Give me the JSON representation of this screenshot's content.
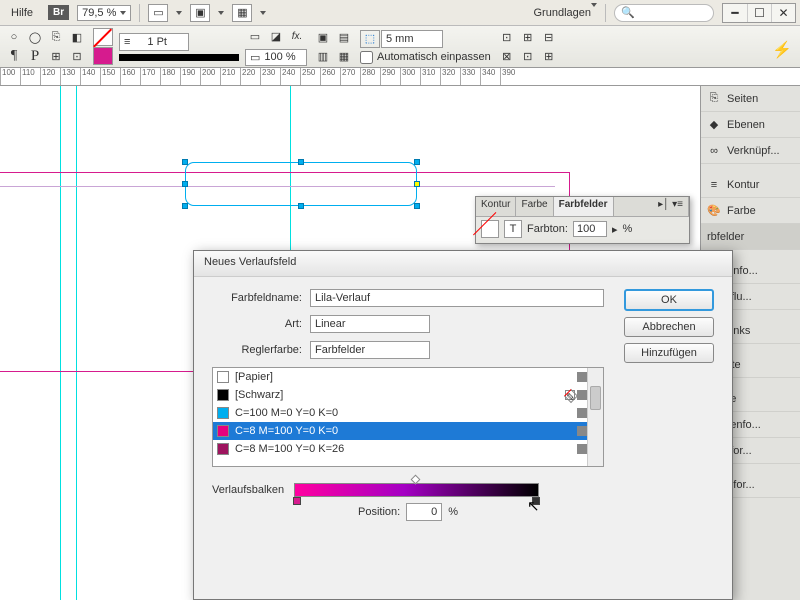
{
  "topbar": {
    "hilfe": "Hilfe",
    "br": "Br",
    "zoom": "79,5 %",
    "workspace": "Grundlagen"
  },
  "toolbar": {
    "stroke_wt": "1 Pt",
    "opacity": "100 %",
    "gap": "5 mm",
    "autofit": "Automatisch einpassen"
  },
  "ruler": [
    "100",
    "110",
    "120",
    "130",
    "140",
    "150",
    "160",
    "170",
    "180",
    "190",
    "200",
    "210",
    "220",
    "230",
    "240",
    "250",
    "260",
    "270",
    "280",
    "290",
    "300",
    "310",
    "320",
    "330",
    "340",
    "390"
  ],
  "rpanel": {
    "seiten": "Seiten",
    "ebenen": "Ebenen",
    "verkn": "Verknüpf...",
    "kontur": "Kontur",
    "farbe": "Farbe",
    "farbfelder": "rbfelder",
    "eichen": "eichenfo...",
    "extumfl": "xtumflu...",
    "yperlinks": "yperlinks",
    "ttribute": "ttribute",
    "abelle": "abelle",
    "abellenfo": "abellenfo...",
    "ellenfor": "ellenfor...",
    "bsatzfor": "bsatzfor..."
  },
  "farbpanel": {
    "t_kontur": "Kontur",
    "t_farbe": "Farbe",
    "t_farbfelder": "Farbfelder",
    "farbton_lbl": "Farbton:",
    "farbton_val": "100",
    "ohne": "[Ohn"
  },
  "dialog": {
    "title": "Neues Verlaufsfeld",
    "name_lbl": "Farbfeldname:",
    "name_val": "Lila-Verlauf",
    "art_lbl": "Art:",
    "art_val": "Linear",
    "regler_lbl": "Reglerfarbe:",
    "regler_val": "Farbfelder",
    "swatches": [
      {
        "name": "[Papier]",
        "color": "#ffffff"
      },
      {
        "name": "[Schwarz]",
        "color": "#000000",
        "noedit": true
      },
      {
        "name": "C=100 M=0 Y=0 K=0",
        "color": "#00aeef"
      },
      {
        "name": "C=8 M=100 Y=0 K=0",
        "color": "#e6007e",
        "sel": true
      },
      {
        "name": "C=8 M=100 Y=0 K=26",
        "color": "#9e145f"
      }
    ],
    "verlauf_lbl": "Verlaufsbalken",
    "pos_lbl": "Position:",
    "pos_val": "0",
    "pos_unit": "%",
    "ok": "OK",
    "cancel": "Abbrechen",
    "add": "Hinzufügen"
  }
}
